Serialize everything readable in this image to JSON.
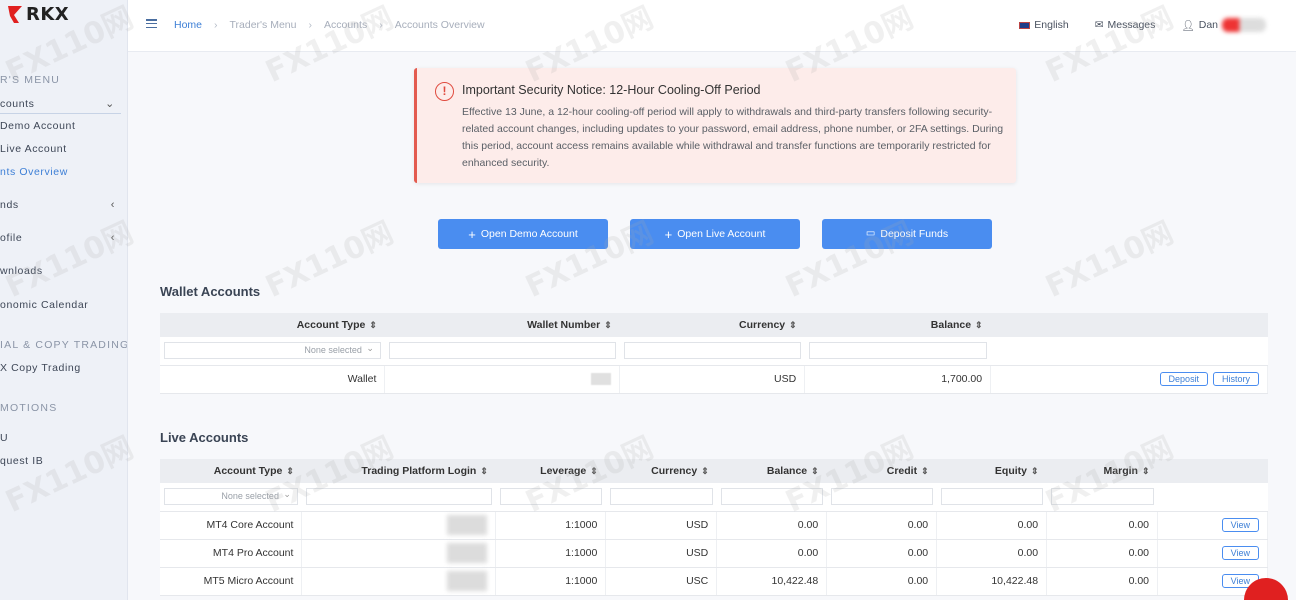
{
  "logo": {
    "text": "RKX"
  },
  "sidebar": {
    "sections": [
      {
        "label": "R'S MENU"
      },
      {
        "label": "IAL & COPY TRADING"
      },
      {
        "label": "MOTIONS"
      }
    ],
    "items": [
      {
        "label": "counts"
      },
      {
        "label": "Demo Account"
      },
      {
        "label": "Live Account"
      },
      {
        "label": "nts Overview"
      },
      {
        "label": "nds"
      },
      {
        "label": "ofile"
      },
      {
        "label": "wnloads"
      },
      {
        "label": "onomic Calendar"
      },
      {
        "label": "X Copy Trading"
      },
      {
        "label": "U"
      },
      {
        "label": "quest IB"
      }
    ]
  },
  "topbar": {
    "breadcrumb": [
      "Home",
      "Trader's Menu",
      "Accounts",
      "Accounts Overview"
    ],
    "separator": "›",
    "language": "English",
    "messages": "Messages",
    "user": "Dan"
  },
  "notice": {
    "title": "Important Security Notice: 12-Hour Cooling-Off Period",
    "body": "Effective 13 June, a 12-hour cooling-off period will apply to withdrawals and third-party transfers following security-related account changes, including updates to your password, email address, phone number, or 2FA settings. During this period, account access remains available while withdrawal and transfer functions are temporarily restricted for enhanced security."
  },
  "actions": {
    "open_demo": "Open Demo Account",
    "open_live": "Open Live Account",
    "deposit": "Deposit Funds"
  },
  "wallet": {
    "title": "Wallet Accounts",
    "columns": [
      "Account Type",
      "Wallet Number",
      "Currency",
      "Balance"
    ],
    "filter_placeholder": "None selected",
    "rows": [
      {
        "type": "Wallet",
        "number": "",
        "currency": "USD",
        "balance": "1,700.00",
        "btn1": "Deposit",
        "btn2": "History"
      }
    ]
  },
  "live": {
    "title": "Live Accounts",
    "columns": [
      "Account Type",
      "Trading Platform Login",
      "Leverage",
      "Currency",
      "Balance",
      "Credit",
      "Equity",
      "Margin"
    ],
    "filter_placeholder": "None selected",
    "view_label": "View",
    "rows": [
      {
        "type": "MT4 Core Account",
        "login": "",
        "leverage": "1:1000",
        "currency": "USD",
        "balance": "0.00",
        "credit": "0.00",
        "equity": "0.00",
        "margin": "0.00"
      },
      {
        "type": "MT4 Pro Account",
        "login": "",
        "leverage": "1:1000",
        "currency": "USD",
        "balance": "0.00",
        "credit": "0.00",
        "equity": "0.00",
        "margin": "0.00"
      },
      {
        "type": "MT5 Micro Account",
        "login": "",
        "leverage": "1:1000",
        "currency": "USC",
        "balance": "10,422.48",
        "credit": "0.00",
        "equity": "10,422.48",
        "margin": "0.00"
      }
    ]
  },
  "watermark": "FX110网"
}
